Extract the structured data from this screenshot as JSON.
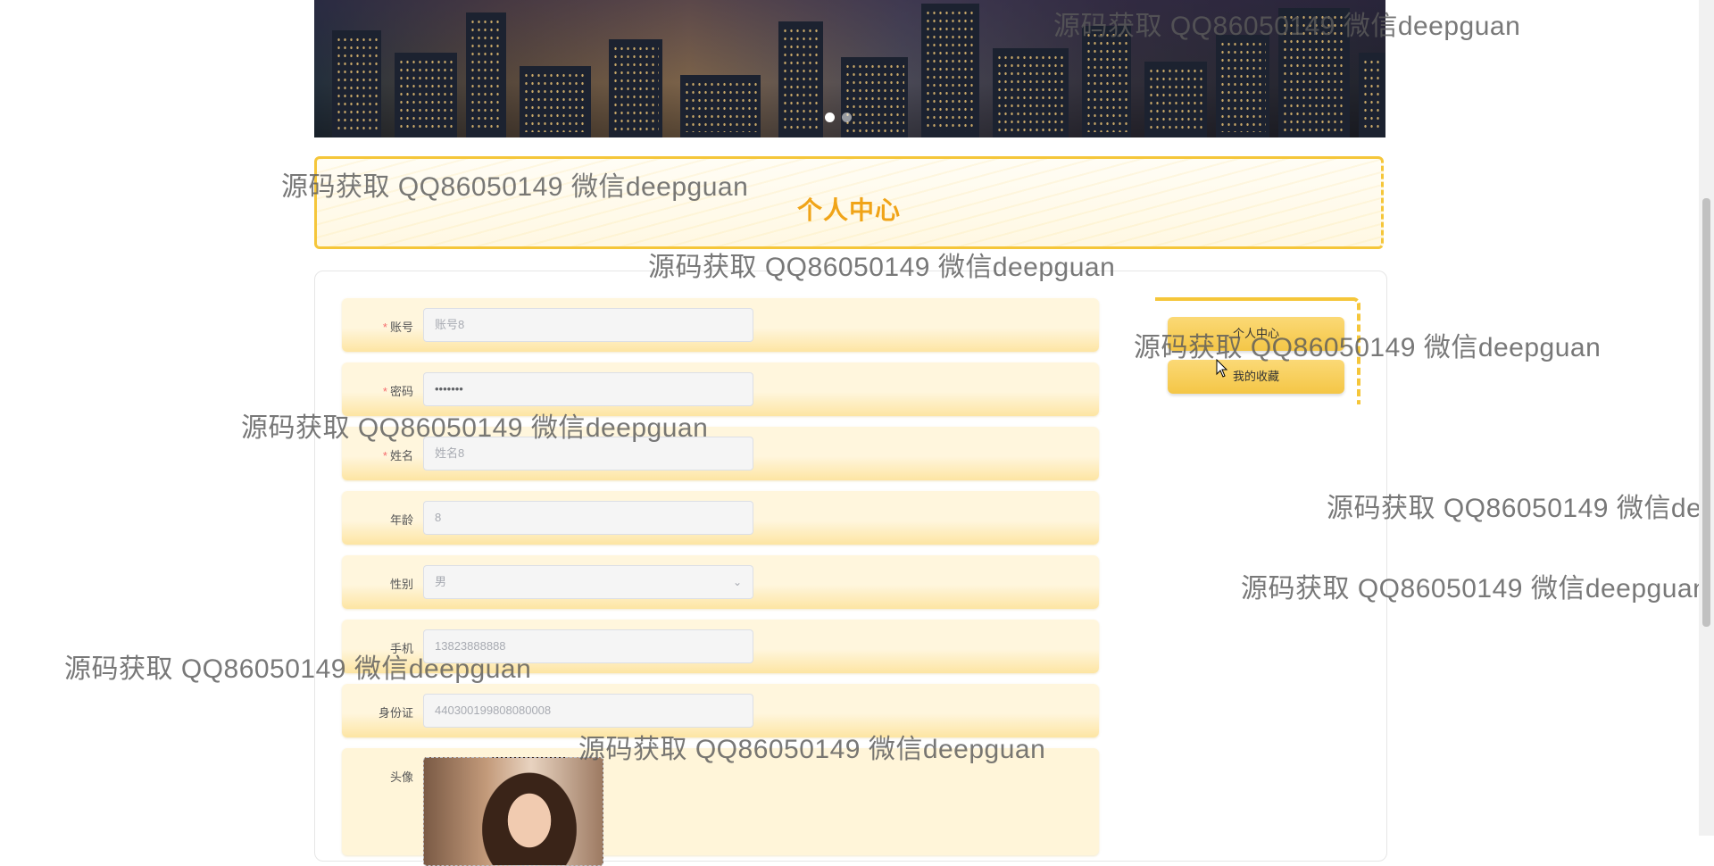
{
  "page": {
    "title": "个人中心"
  },
  "banner": {
    "slide_count": 2,
    "active_slide": 1
  },
  "form": {
    "fields": [
      {
        "label": "账号",
        "required": true,
        "value": "",
        "placeholder": "账号8"
      },
      {
        "label": "密码",
        "required": true,
        "value": "•••••••",
        "placeholder": ""
      },
      {
        "label": "姓名",
        "required": true,
        "value": "",
        "placeholder": "姓名8"
      },
      {
        "label": "年龄",
        "required": false,
        "value": "",
        "placeholder": "8"
      },
      {
        "label": "性别",
        "required": false,
        "value": "男",
        "placeholder": "",
        "type": "select"
      },
      {
        "label": "手机",
        "required": false,
        "value": "",
        "placeholder": "13823888888"
      },
      {
        "label": "身份证",
        "required": false,
        "value": "",
        "placeholder": "440300199808080008"
      },
      {
        "label": "头像",
        "required": false,
        "type": "image"
      }
    ],
    "required_mark": "*"
  },
  "side_menu": {
    "items": [
      {
        "label": "个人中心"
      },
      {
        "label": "我的收藏"
      }
    ]
  },
  "watermark": {
    "text": "源码获取 QQ86050149 微信deepguan"
  },
  "colors": {
    "accent": "#f0a418",
    "border": "#f5c63a",
    "row_bg": "#fff6dd",
    "button": "#f4c646"
  }
}
